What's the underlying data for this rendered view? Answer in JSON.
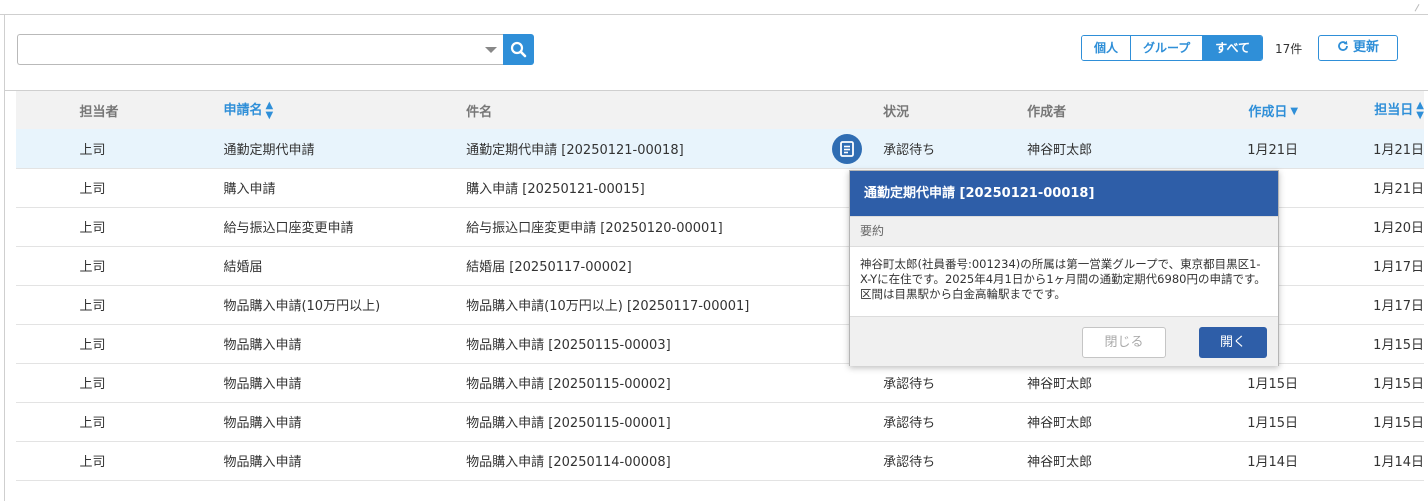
{
  "search": {
    "value": "",
    "placeholder": ""
  },
  "filters": {
    "options": [
      "個人",
      "グループ",
      "すべて"
    ],
    "selected": "すべて"
  },
  "count_label": "17件",
  "refresh_label": "更新",
  "table": {
    "headers": {
      "assignee": "担当者",
      "request_name": "申請名",
      "subject": "件名",
      "status": "状況",
      "creator": "作成者",
      "created_date": "作成日",
      "assigned_date": "担当日"
    },
    "rows": [
      {
        "assignee": "上司",
        "request_name": "通勤定期代申請",
        "subject": "通勤定期代申請 [20250121-00018]",
        "status": "承認待ち",
        "creator": "神谷町太郎",
        "created_date": "1月21日",
        "assigned_date": "1月21日"
      },
      {
        "assignee": "上司",
        "request_name": "購入申請",
        "subject": "購入申請 [20250121-00015]",
        "status": "",
        "creator": "",
        "created_date": "",
        "assigned_date": "1月21日"
      },
      {
        "assignee": "上司",
        "request_name": "給与振込口座変更申請",
        "subject": "給与振込口座変更申請 [20250120-00001]",
        "status": "",
        "creator": "",
        "created_date": "",
        "assigned_date": "1月20日"
      },
      {
        "assignee": "上司",
        "request_name": "結婚届",
        "subject": "結婚届 [20250117-00002]",
        "status": "",
        "creator": "",
        "created_date": "",
        "assigned_date": "1月17日"
      },
      {
        "assignee": "上司",
        "request_name": "物品購入申請(10万円以上)",
        "subject": "物品購入申請(10万円以上) [20250117-00001]",
        "status": "",
        "creator": "",
        "created_date": "",
        "assigned_date": "1月17日"
      },
      {
        "assignee": "上司",
        "request_name": "物品購入申請",
        "subject": "物品購入申請 [20250115-00003]",
        "status": "",
        "creator": "",
        "created_date": "",
        "assigned_date": "1月15日"
      },
      {
        "assignee": "上司",
        "request_name": "物品購入申請",
        "subject": "物品購入申請 [20250115-00002]",
        "status": "承認待ち",
        "creator": "神谷町太郎",
        "created_date": "1月15日",
        "assigned_date": "1月15日"
      },
      {
        "assignee": "上司",
        "request_name": "物品購入申請",
        "subject": "物品購入申請 [20250115-00001]",
        "status": "承認待ち",
        "creator": "神谷町太郎",
        "created_date": "1月15日",
        "assigned_date": "1月15日"
      },
      {
        "assignee": "上司",
        "request_name": "物品購入申請",
        "subject": "物品購入申請 [20250114-00008]",
        "status": "承認待ち",
        "creator": "神谷町太郎",
        "created_date": "1月14日",
        "assigned_date": "1月14日"
      }
    ]
  },
  "popup": {
    "title": "通勤定期代申請 [20250121-00018]",
    "section_label": "要約",
    "body": "神谷町太郎(社員番号:001234)の所属は第一営業グループで、東京都目黒区1-X-Yに在住です。2025年4月1日から1ヶ月間の通勤定期代6980円の申請です。区間は目黒駅から白金高輪駅までです。",
    "close_label": "閉じる",
    "open_label": "開く"
  },
  "colors": {
    "accent": "#2f8fd8",
    "popup_header": "#2e5ea8",
    "selected_row": "#e8f4fc"
  }
}
